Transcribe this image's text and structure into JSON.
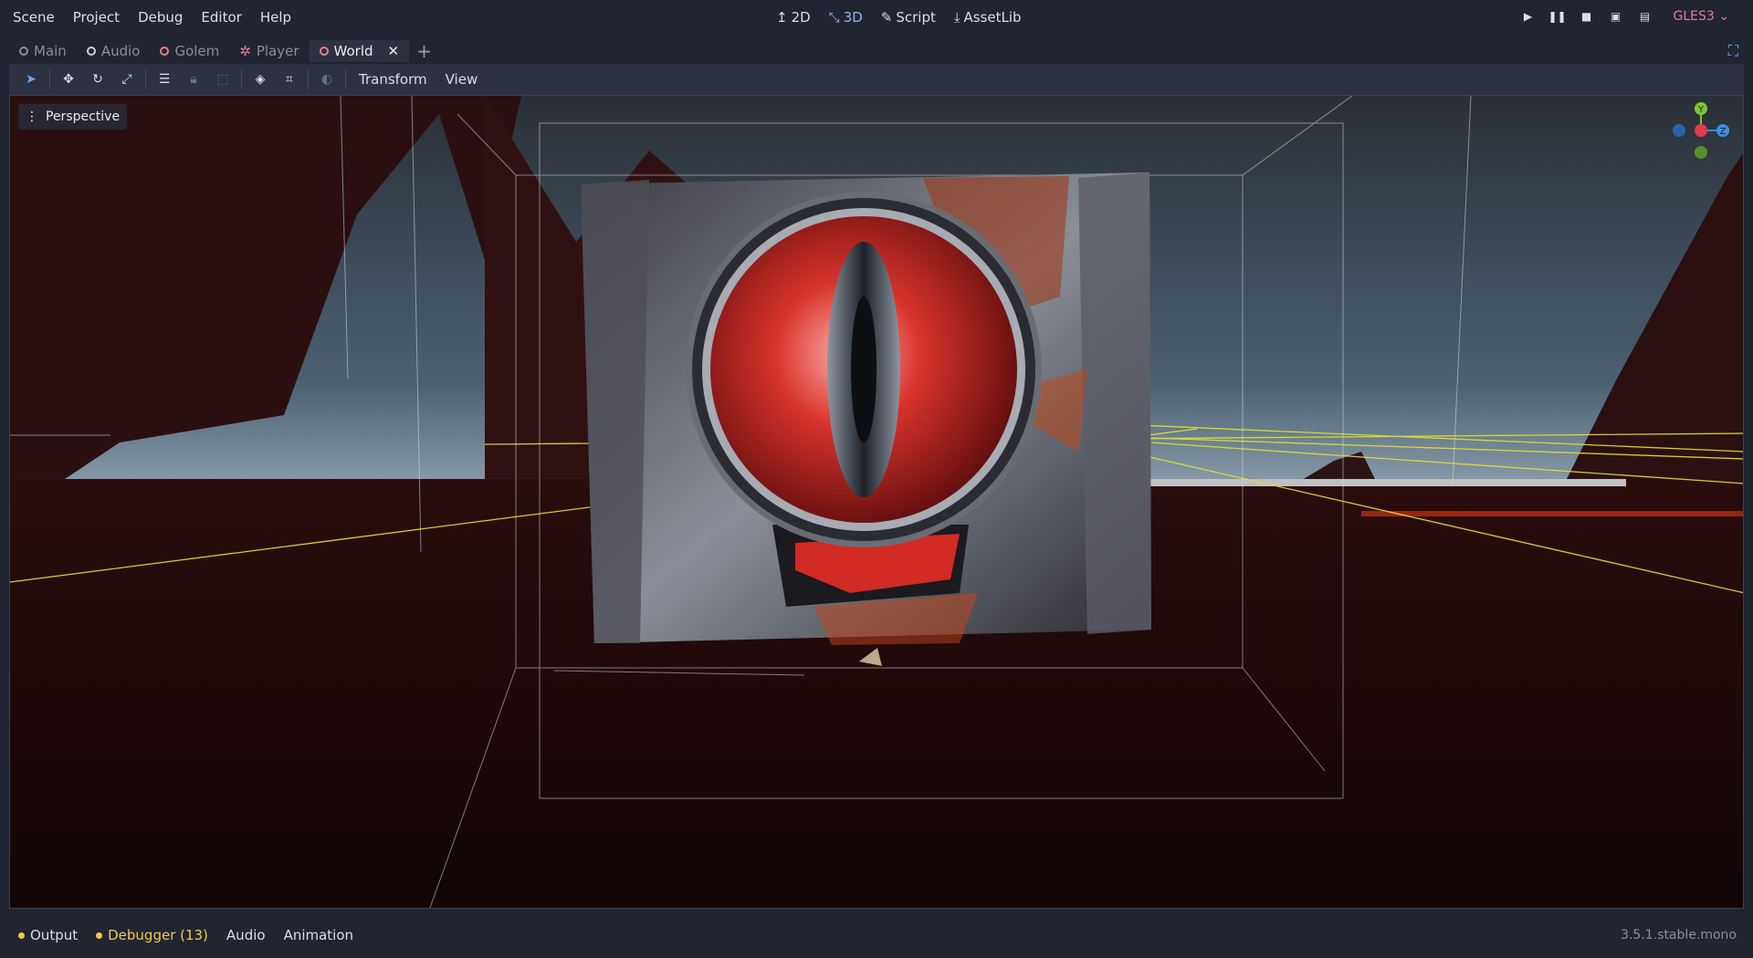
{
  "menu": [
    "Scene",
    "Project",
    "Debug",
    "Editor",
    "Help"
  ],
  "modes": [
    {
      "label": "2D",
      "icon": "2d-icon"
    },
    {
      "label": "3D",
      "icon": "3d-icon",
      "active": true
    },
    {
      "label": "Script",
      "icon": "script-icon"
    },
    {
      "label": "AssetLib",
      "icon": "assetlib-icon"
    }
  ],
  "renderer": "GLES3",
  "tabs": [
    {
      "label": "Main"
    },
    {
      "label": "Audio"
    },
    {
      "label": "Golem"
    },
    {
      "label": "Player"
    },
    {
      "label": "World",
      "active": true
    }
  ],
  "toolbar": {
    "transform": "Transform",
    "view": "View"
  },
  "viewport": {
    "perspective": "Perspective"
  },
  "gizmo": {
    "y": "Y",
    "z": "Z"
  },
  "bottom": {
    "output": "Output",
    "debugger": "Debugger (13)",
    "audio": "Audio",
    "animation": "Animation",
    "version": "3.5.1.stable.mono"
  }
}
